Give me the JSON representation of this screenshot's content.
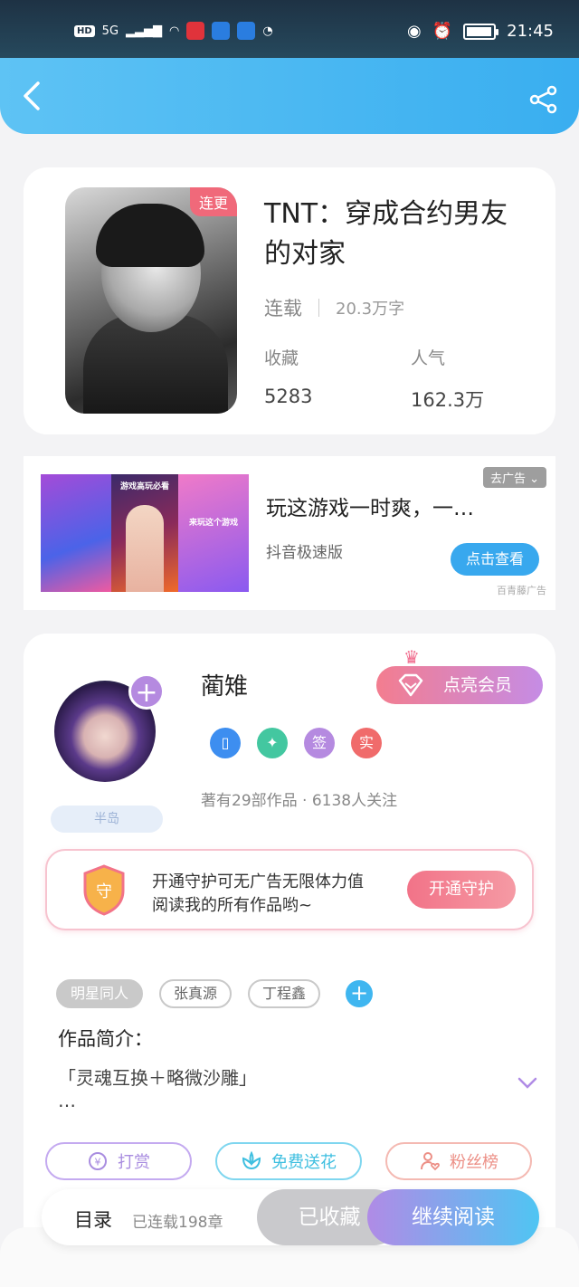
{
  "status_bar": {
    "hd": "HD",
    "network": "5G",
    "time": "21:45",
    "battery_level": 0.85
  },
  "book": {
    "badge": "连更",
    "title": "TNT：穿成合约男友的对家",
    "status": "连载",
    "word_count": "20.3万字",
    "favorites_label": "收藏",
    "favorites_value": "5283",
    "popularity_label": "人气",
    "popularity_value": "162.3万"
  },
  "ad": {
    "close_label": "去广告",
    "title": "玩这游戏一时爽，一…",
    "source": "抖音极速版",
    "cta": "点击查看",
    "credit": "百青藤广告",
    "img_caption_1": "游戏高玩必看",
    "img_caption_2": "来玩这个游戏"
  },
  "author": {
    "name": "蔺雉",
    "vip_button": "点亮会员",
    "tag": "半岛",
    "badge_sign": "签",
    "badge_real": "实",
    "works_summary": "著有29部作品 · 6138人关注"
  },
  "guard": {
    "icon_label": "守",
    "text_line1": "开通守护可无广告无限体力值",
    "text_line2": "阅读我的所有作品哟~",
    "button": "开通守护"
  },
  "tags": [
    "明星同人",
    "张真源",
    "丁程鑫"
  ],
  "intro": {
    "title": "作品简介：",
    "text": "「灵魂互换＋略微沙雕」",
    "more": "…"
  },
  "actions": {
    "tip": "打赏",
    "flower": "免费送花",
    "fans": "粉丝榜"
  },
  "bottom_bar": {
    "toc": "目录",
    "chapters": "已连载198章",
    "collected": "已收藏",
    "continue": "继续阅读"
  },
  "colors": {
    "header": "#39aef0",
    "vip_gradient_start": "#f37d8f",
    "vip_gradient_end": "#c58ce5",
    "guard_button": "#f27388",
    "tip_color": "#a98de0",
    "flower_color": "#3fbfe0",
    "fans_color": "#ec8f86"
  }
}
